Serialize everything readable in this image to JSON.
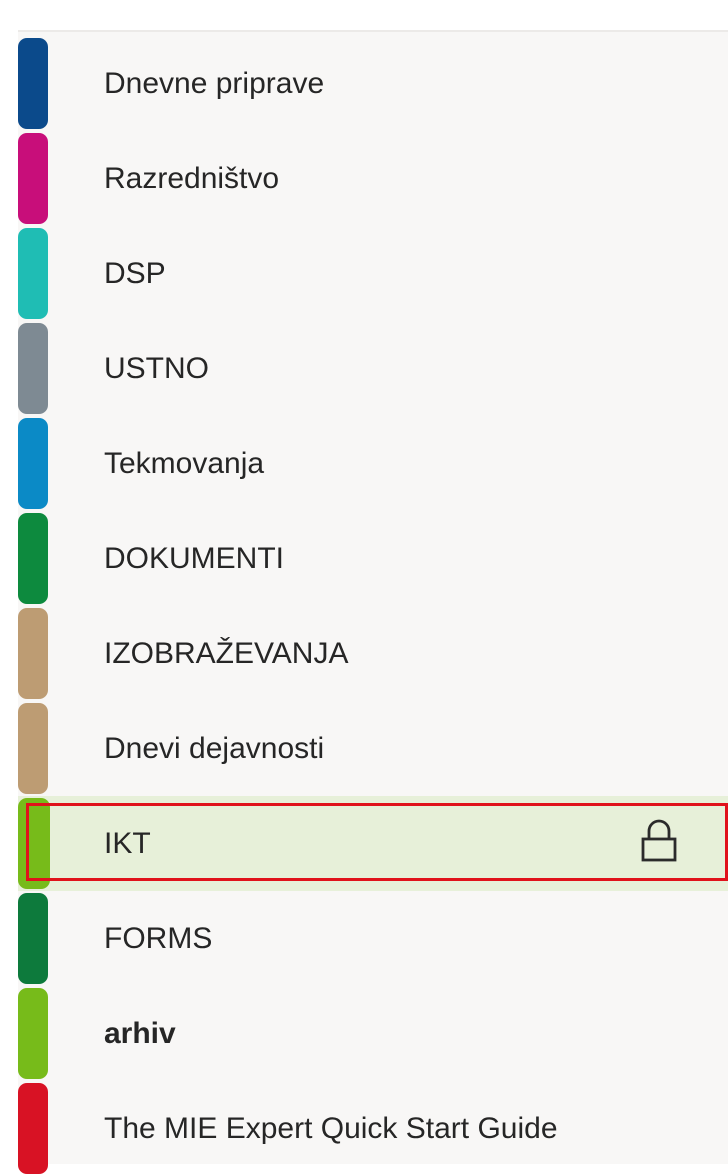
{
  "sections": [
    {
      "label": "Dnevne priprave",
      "color": "#0b4a8b"
    },
    {
      "label": "Razredništvo",
      "color": "#c80e7a"
    },
    {
      "label": "DSP",
      "color": "#1fbdb4"
    },
    {
      "label": "USTNO",
      "color": "#7e8a93"
    },
    {
      "label": "Tekmovanja",
      "color": "#0b8ac6"
    },
    {
      "label": "DOKUMENTI",
      "color": "#0d8a3e"
    },
    {
      "label": "IZOBRAŽEVANJA",
      "color": "#bd9c73"
    },
    {
      "label": "Dnevi dejavnosti",
      "color": "#bd9c73"
    },
    {
      "label": "IKT",
      "color": "#77bb1a",
      "selected": true,
      "locked": true
    },
    {
      "label": "FORMS",
      "color": "#0d7a3c"
    },
    {
      "label": "arhiv",
      "color": "#77bb1a",
      "bold": true
    },
    {
      "label": "The MIE Expert Quick Start Guide",
      "color": "#d81224"
    }
  ],
  "selected_section": {
    "label": "IKT",
    "icon": "lock-icon",
    "highlight_color": "#e7f0d9",
    "outline_color": "#e0121b"
  }
}
